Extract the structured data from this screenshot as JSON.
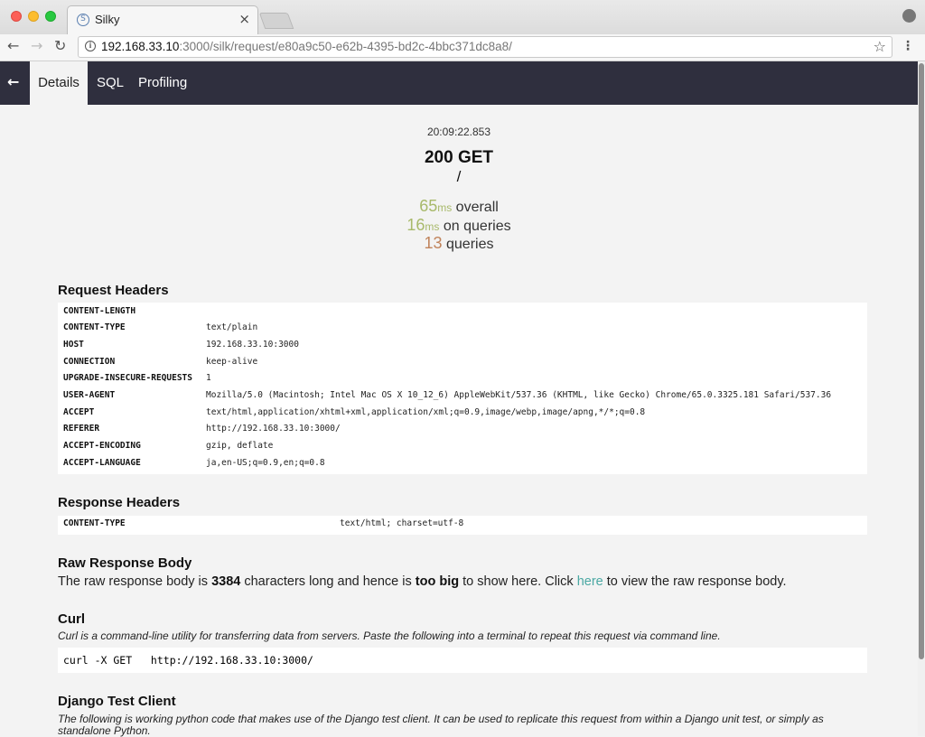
{
  "browser": {
    "tab_title": "Silky",
    "url_host": "192.168.33.10",
    "url_rest": ":3000/silk/request/e80a9c50-e62b-4395-bd2c-4bbc371dc8a8/"
  },
  "nav": {
    "back": "←",
    "tabs": [
      {
        "label": "Details"
      },
      {
        "label": "SQL"
      },
      {
        "label": "Profiling"
      }
    ]
  },
  "summary": {
    "time": "20:09:22.853",
    "status": "200 GET",
    "path": "/",
    "overall_value": "65",
    "overall_unit": "ms",
    "overall_label": "overall",
    "queries_time_value": "16",
    "queries_time_unit": "ms",
    "queries_time_label": "on queries",
    "queries_count": "13",
    "queries_label": "queries"
  },
  "request_headers": {
    "title": "Request Headers",
    "rows": [
      {
        "key": "CONTENT-LENGTH",
        "value": ""
      },
      {
        "key": "CONTENT-TYPE",
        "value": "text/plain"
      },
      {
        "key": "HOST",
        "value": "192.168.33.10:3000"
      },
      {
        "key": "CONNECTION",
        "value": "keep-alive"
      },
      {
        "key": "UPGRADE-INSECURE-REQUESTS",
        "value": "1"
      },
      {
        "key": "USER-AGENT",
        "value": "Mozilla/5.0 (Macintosh; Intel Mac OS X 10_12_6) AppleWebKit/537.36 (KHTML, like Gecko) Chrome/65.0.3325.181 Safari/537.36"
      },
      {
        "key": "ACCEPT",
        "value": "text/html,application/xhtml+xml,application/xml;q=0.9,image/webp,image/apng,*/*;q=0.8"
      },
      {
        "key": "REFERER",
        "value": "http://192.168.33.10:3000/"
      },
      {
        "key": "ACCEPT-ENCODING",
        "value": "gzip, deflate"
      },
      {
        "key": "ACCEPT-LANGUAGE",
        "value": "ja,en-US;q=0.9,en;q=0.8"
      }
    ]
  },
  "response_headers": {
    "title": "Response Headers",
    "rows": [
      {
        "key": "CONTENT-TYPE",
        "value": "text/html; charset=utf-8"
      }
    ]
  },
  "raw_body": {
    "title": "Raw Response Body",
    "text_1": "The raw response body is",
    "length": "3384",
    "text_2": "characters long and hence is",
    "too_big": "too big",
    "text_3": "to show here. Click",
    "link": "here",
    "text_4": "to view the raw response body."
  },
  "curl": {
    "title": "Curl",
    "description": "Curl is a command-line utility for transferring data from servers. Paste the following into a terminal to repeat this request via command line.",
    "command": "curl -X GET   http://192.168.33.10:3000/"
  },
  "django": {
    "title": "Django Test Client",
    "description": "The following is working python code that makes use of the Django test client. It can be used to replicate this request from within a Django unit test, or simply as standalone Python."
  }
}
